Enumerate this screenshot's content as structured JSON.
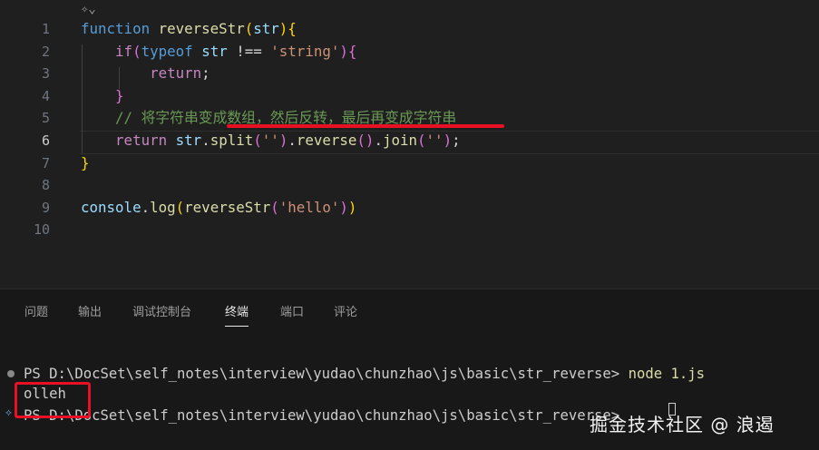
{
  "editor": {
    "top_icon": "sparkle-chevron-icon",
    "active_line": 6,
    "lines": [
      {
        "num": "1"
      },
      {
        "num": "2"
      },
      {
        "num": "3"
      },
      {
        "num": "4"
      },
      {
        "num": "5"
      },
      {
        "num": "6"
      },
      {
        "num": "7"
      },
      {
        "num": "8"
      },
      {
        "num": "9"
      },
      {
        "num": "10"
      }
    ],
    "tokens": {
      "l1_kw": "function",
      "l1_sp": " ",
      "l1_fn": "reverseStr",
      "l1_p1": "(",
      "l1_arg": "str",
      "l1_p2": ")",
      "l1_b": "{",
      "l2_indent": "    ",
      "l2_if": "if",
      "l2_p1": "(",
      "l2_typeof": "typeof",
      "l2_sp1": " ",
      "l2_var": "str",
      "l2_op": " !== ",
      "l2_str": "'string'",
      "l2_p2": ")",
      "l2_b": "{",
      "l3_indent": "        ",
      "l3_ret": "return",
      "l3_semi": ";",
      "l4_indent": "    ",
      "l4_b": "}",
      "l5_indent": "    ",
      "l5_com": "// 将字符串变成数组，然后反转，最后再变成字符串",
      "l6_indent": "    ",
      "l6_ret": "return",
      "l6_sp": " ",
      "l6_var": "str",
      "l6_dot1": ".",
      "l6_split": "split",
      "l6_p1": "(",
      "l6_s1": "''",
      "l6_p2": ")",
      "l6_dot2": ".",
      "l6_rev": "reverse",
      "l6_p3": "()",
      "l6_dot3": ".",
      "l6_join": "join",
      "l6_p4": "(",
      "l6_s2": "''",
      "l6_p5": ")",
      "l6_semi": ";",
      "l7_b": "}",
      "l9_var": "console",
      "l9_dot": ".",
      "l9_log": "log",
      "l9_p1": "(",
      "l9_fn": "reverseStr",
      "l9_p2": "(",
      "l9_str": "'hello'",
      "l9_p3": ")",
      "l9_p4": ")"
    }
  },
  "panel": {
    "tabs": [
      "问题",
      "输出",
      "调试控制台",
      "终端",
      "端口",
      "评论"
    ],
    "active_tab": "终端",
    "terminal": {
      "prompt1": "PS D:\\DocSet\\self_notes\\interview\\yudao\\chunzhao\\js\\basic\\str_reverse> ",
      "command": "node 1.js",
      "output": "olleh",
      "prompt2": "PS D:\\DocSet\\self_notes\\interview\\yudao\\chunzhao\\js\\basic\\str_reverse> "
    }
  },
  "watermark": "掘金技术社区 @ 浪遏",
  "colors": {
    "background": "#1f1f1f",
    "keyword": "#569cd6",
    "control": "#c586c0",
    "function": "#dcdcaa",
    "string": "#ce9178",
    "comment": "#6a9955",
    "highlight": "#e81123"
  }
}
